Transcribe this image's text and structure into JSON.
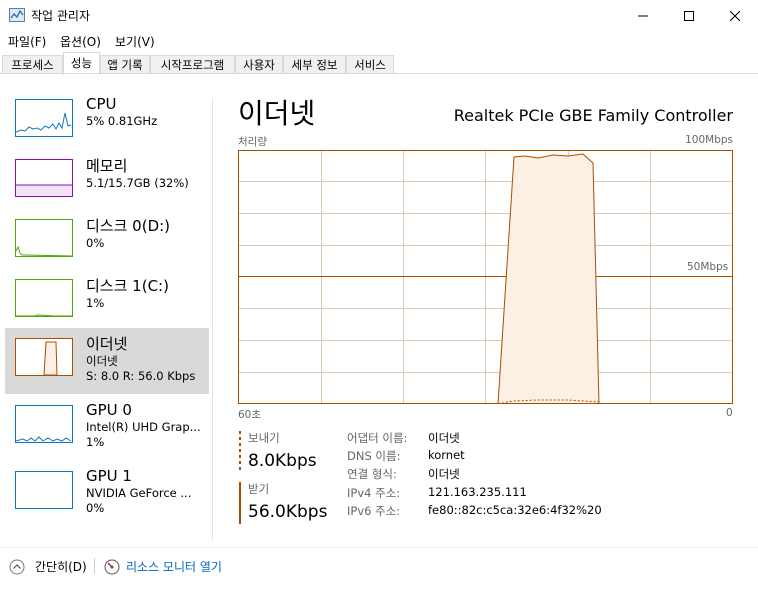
{
  "window": {
    "title": "작업 관리자"
  },
  "menu": [
    {
      "label": "파일(F)"
    },
    {
      "label": "옵션(O)"
    },
    {
      "label": "보기(V)"
    }
  ],
  "tabs": [
    {
      "label": "프로세스"
    },
    {
      "label": "성능",
      "active": true
    },
    {
      "label": "앱 기록"
    },
    {
      "label": "시작프로그램"
    },
    {
      "label": "사용자"
    },
    {
      "label": "세부 정보"
    },
    {
      "label": "서비스"
    }
  ],
  "sidebar": [
    {
      "name": "CPU",
      "sub1": "5% 0.81GHz",
      "sub2": "",
      "color": "#1177bb"
    },
    {
      "name": "메모리",
      "sub1": "5.1/15.7GB (32%)",
      "sub2": "",
      "color": "#8b12ae"
    },
    {
      "name": "디스크 0(D:)",
      "sub1": "0%",
      "sub2": "",
      "color": "#4da60c"
    },
    {
      "name": "디스크 1(C:)",
      "sub1": "1%",
      "sub2": "",
      "color": "#4da60c"
    },
    {
      "name": "이더넷",
      "sub1": "이더넷",
      "sub2": "S: 8.0  R: 56.0 Kbps",
      "color": "#a74f01",
      "active": true
    },
    {
      "name": "GPU 0",
      "sub1": "Intel(R) UHD Grap...",
      "sub2": "1%",
      "color": "#1177bb"
    },
    {
      "name": "GPU 1",
      "sub1": "NVIDIA GeForce ...",
      "sub2": "0%",
      "color": "#1177bb"
    }
  ],
  "main": {
    "title": "이더넷",
    "adapter": "Realtek PCIe GBE Family Controller",
    "graph": {
      "label": "처리량",
      "max_label": "100Mbps",
      "mid_label": "50Mbps",
      "time_left": "60초",
      "time_right": "0",
      "color": "#a74f01",
      "fill": "#fcefe3"
    },
    "send": {
      "label": "보내기",
      "value": "8.0Kbps"
    },
    "receive": {
      "label": "받기",
      "value": "56.0Kbps"
    },
    "props": [
      {
        "label": "어댑터 이름:",
        "value": "이더넷"
      },
      {
        "label": "DNS 이름:",
        "value": "kornet"
      },
      {
        "label": "연결 형식:",
        "value": "이더넷"
      },
      {
        "label": "IPv4 주소:",
        "value": "121.163.235.111"
      },
      {
        "label": "IPv6 주소:",
        "value": "fe80::82c:c5ca:32e6:4f32%20"
      }
    ]
  },
  "footer": {
    "collapse": "간단히(D)",
    "resmon": "리소스 모니터 열기"
  }
}
